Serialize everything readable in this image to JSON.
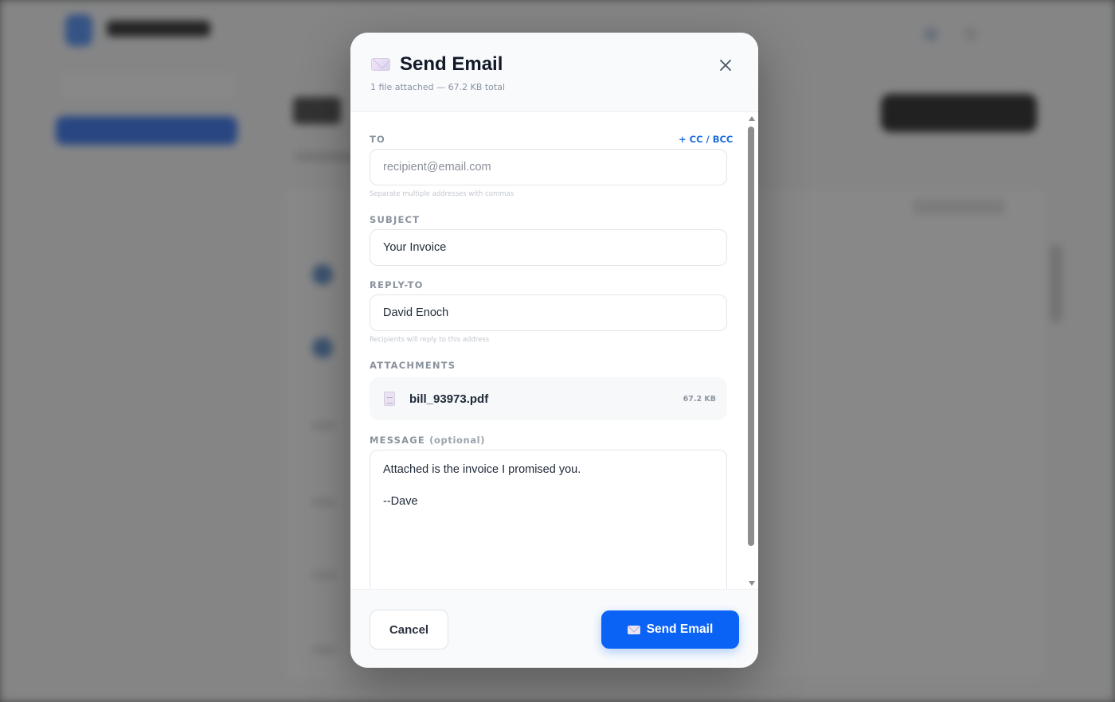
{
  "modal": {
    "title": "Send Email",
    "subtitle": "1 file attached — 67.2 KB total",
    "title_icon": "envelope-icon",
    "close_icon": "close-icon"
  },
  "form": {
    "to": {
      "label": "TO",
      "cc_bcc_link": "+ CC / BCC",
      "placeholder": "recipient@email.com",
      "value": "",
      "hint": "Separate multiple addresses with commas"
    },
    "subject": {
      "label": "SUBJECT",
      "value": "Your Invoice"
    },
    "reply_to": {
      "label": "REPLY-TO",
      "value": "David Enoch",
      "hint": "Recipients will reply to this address"
    },
    "attachments": {
      "label": "ATTACHMENTS",
      "files": [
        {
          "name": "bill_93973.pdf",
          "size": "67.2 KB",
          "icon": "file-icon"
        }
      ]
    },
    "message": {
      "label": "MESSAGE",
      "label_optional": "(optional)",
      "value": "Attached is the invoice I promised you.\n\n--Dave"
    }
  },
  "footer": {
    "cancel_label": "Cancel",
    "send_label": "Send Email",
    "send_icon": "envelope-icon"
  },
  "colors": {
    "accent": "#0b63f6",
    "link": "#1d6fe0",
    "overlay": "#6a6a6a"
  }
}
